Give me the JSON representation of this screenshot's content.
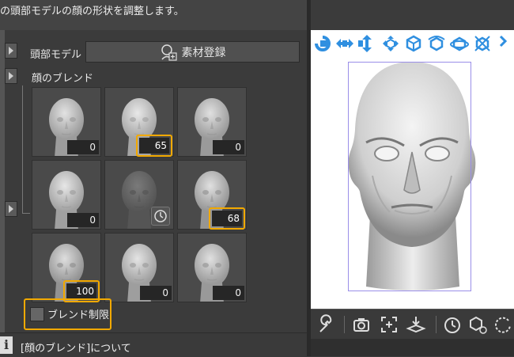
{
  "description": "の頭部モデルの顔の形状を調整します。",
  "head_model": {
    "label": "頭部モデル",
    "register_button": "素材登録"
  },
  "face_blend": {
    "label": "顔のブレンド",
    "cells": [
      {
        "value": "0",
        "highlighted": false
      },
      {
        "value": "65",
        "highlighted": true
      },
      {
        "value": "0",
        "highlighted": false
      },
      {
        "value": "0",
        "highlighted": false
      },
      {
        "value": "",
        "highlighted": false,
        "icon": "timer-icon"
      },
      {
        "value": "68",
        "highlighted": true
      },
      {
        "value": "100",
        "highlighted": true
      },
      {
        "value": "0",
        "highlighted": false
      },
      {
        "value": "0",
        "highlighted": false
      }
    ]
  },
  "blend_limit": {
    "label": "ブレンド制限",
    "checked": false
  },
  "info": {
    "text": "[顔のブレンド]について"
  },
  "colors": {
    "highlight": "#f2a900",
    "accent_blue": "#2f8fe0"
  },
  "toolbar_icons": [
    "rotate-camera-icon",
    "move-horizontal-icon",
    "move-vertical-icon",
    "move-3d-icon",
    "rotate-object-icon",
    "rotate-y-icon",
    "rotate-x-icon",
    "rotate-z-icon"
  ],
  "bottom_icons": [
    "wrench-icon",
    "camera-icon",
    "fit-view-icon",
    "ground-icon",
    "timer-icon",
    "model-pose-icon",
    "rotate-icon"
  ]
}
